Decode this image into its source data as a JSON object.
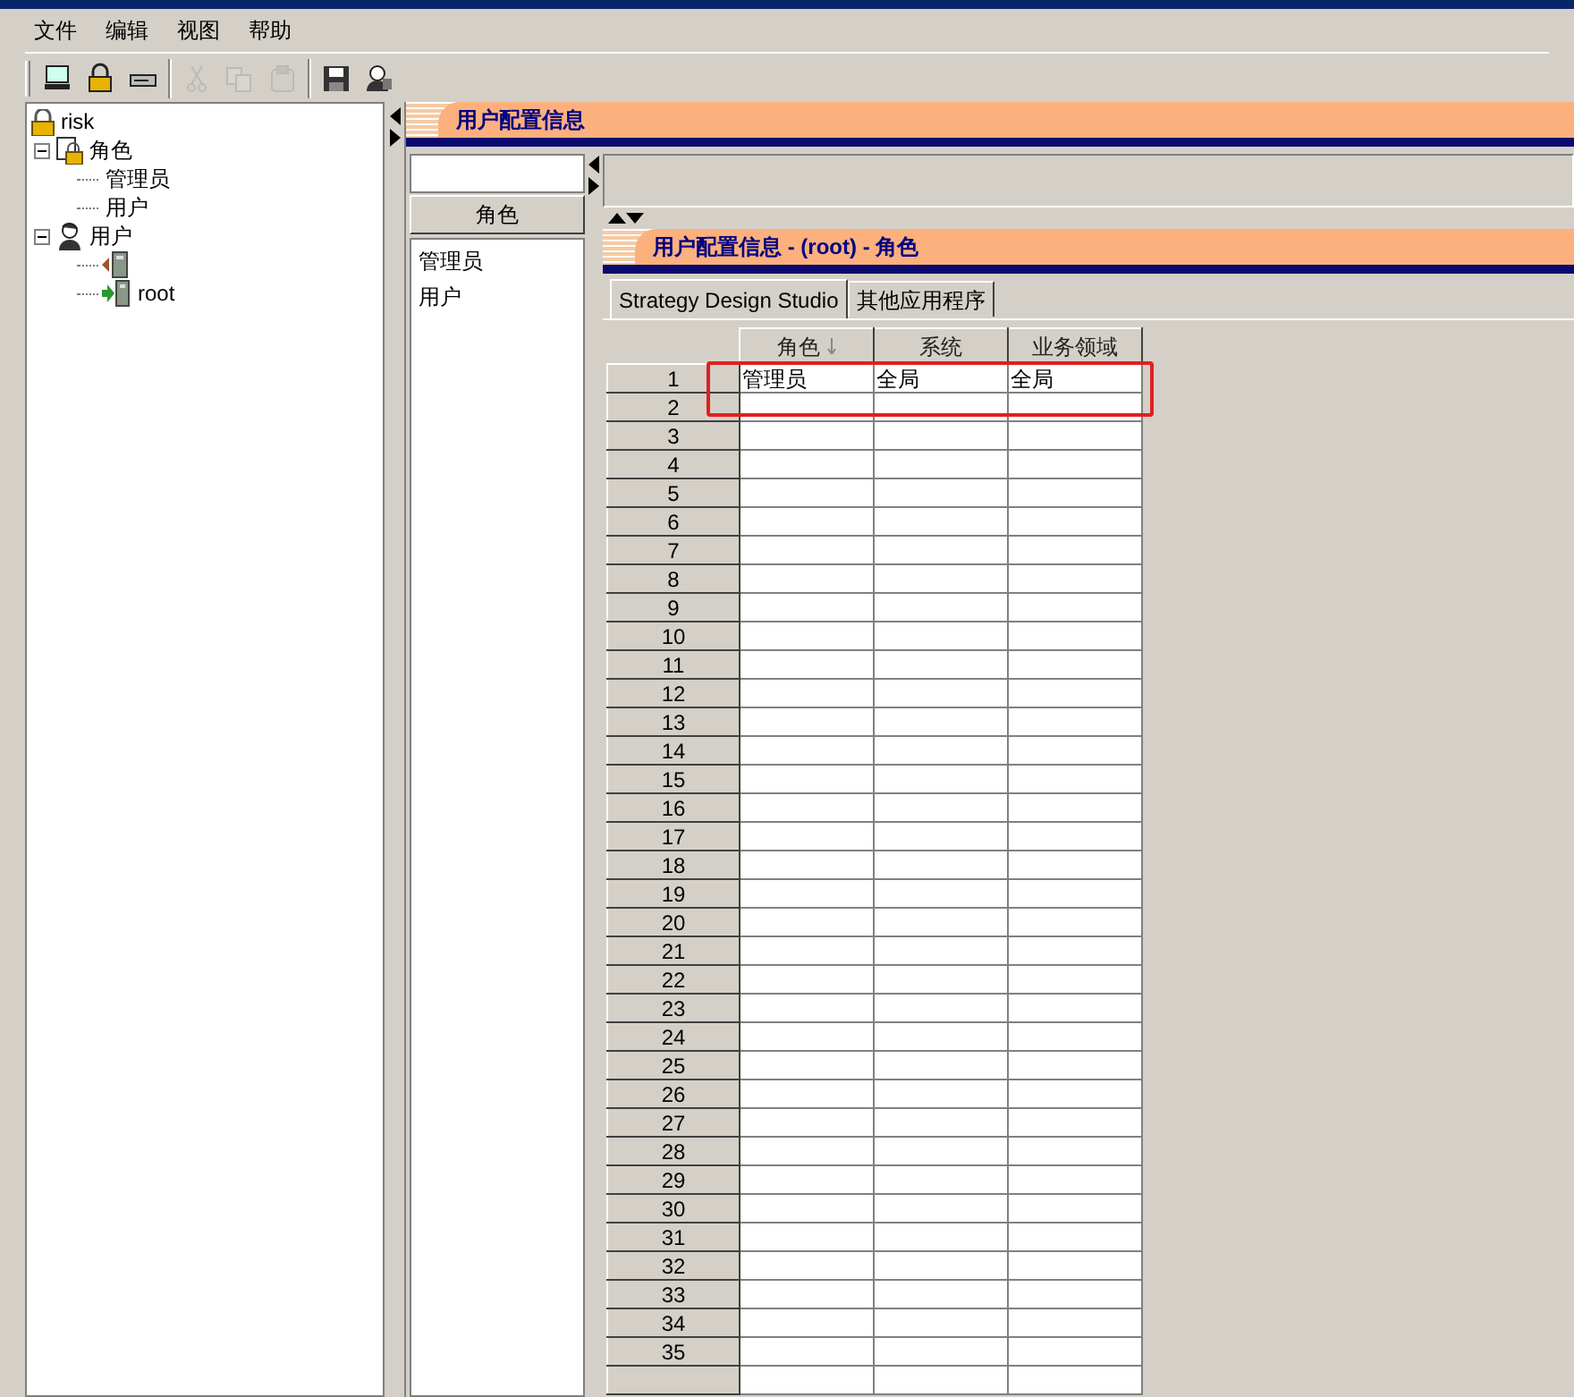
{
  "menu": [
    "文件",
    "编辑",
    "视图",
    "帮助"
  ],
  "toolbar": [
    {
      "kind": "button",
      "disabled": false
    },
    {
      "kind": "button",
      "disabled": false
    },
    {
      "kind": "button",
      "disabled": false
    },
    {
      "kind": "separator"
    },
    {
      "kind": "button",
      "disabled": true
    },
    {
      "kind": "button",
      "disabled": true
    },
    {
      "kind": "button",
      "disabled": true
    },
    {
      "kind": "separator"
    },
    {
      "kind": "button",
      "disabled": false
    },
    {
      "kind": "button",
      "disabled": false
    }
  ],
  "tree": [
    {
      "kind": "root",
      "label": "risk",
      "children": [
        {
          "kind": "group",
          "label": "角色",
          "expanded": true,
          "children": [
            {
              "kind": "item",
              "label": "管理员"
            },
            {
              "kind": "item",
              "label": "用户"
            }
          ]
        },
        {
          "kind": "group",
          "label": "用户",
          "expanded": true,
          "children": [
            {
              "kind": "server"
            },
            {
              "kind": "server",
              "label": "root"
            }
          ]
        }
      ]
    }
  ],
  "banner": {
    "title": "用户配置信息"
  },
  "role_panel": {
    "button": "角色",
    "items": [
      "管理员",
      "用户"
    ]
  },
  "detail_banner": {
    "title": "用户配置信息 - (root) - 角色"
  },
  "tabs": [
    {
      "label": "Strategy Design Studio",
      "selected": true
    },
    {
      "label": "其他应用程序",
      "selected": false
    }
  ],
  "grid": {
    "highlighted": true,
    "columns": [
      {
        "label": "角色",
        "sorted": true
      },
      {
        "label": "系统",
        "sorted": false
      },
      {
        "label": "业务领域",
        "sorted": false
      }
    ],
    "rows": [
      {
        "number": "1",
        "cells": [
          "管理员",
          "全局",
          "全局"
        ]
      },
      {
        "number": "2"
      },
      {
        "number": "3"
      },
      {
        "number": "4"
      },
      {
        "number": "5"
      },
      {
        "number": "6"
      },
      {
        "number": "7"
      },
      {
        "number": "8"
      },
      {
        "number": "9"
      },
      {
        "number": "10"
      },
      {
        "number": "11"
      },
      {
        "number": "12"
      },
      {
        "number": "13"
      },
      {
        "number": "14"
      },
      {
        "number": "15"
      },
      {
        "number": "16"
      },
      {
        "number": "17"
      },
      {
        "number": "18"
      },
      {
        "number": "19"
      },
      {
        "number": "20"
      },
      {
        "number": "21"
      },
      {
        "number": "22"
      },
      {
        "number": "23"
      },
      {
        "number": "24"
      },
      {
        "number": "25"
      },
      {
        "number": "26"
      },
      {
        "number": "27"
      },
      {
        "number": "28"
      },
      {
        "number": "29"
      },
      {
        "number": "30"
      },
      {
        "number": "31"
      },
      {
        "number": "32"
      },
      {
        "number": "33"
      },
      {
        "number": "34"
      },
      {
        "number": "35"
      },
      {}
    ]
  }
}
